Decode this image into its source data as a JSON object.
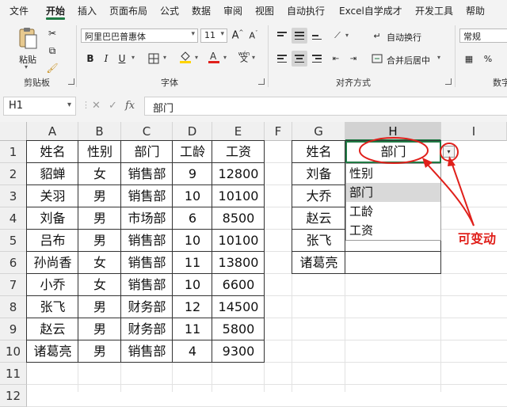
{
  "menu": {
    "items": [
      "文件",
      "开始",
      "插入",
      "页面布局",
      "公式",
      "数据",
      "审阅",
      "视图",
      "自动执行",
      "Excel自学成才",
      "开发工具",
      "帮助"
    ],
    "active_index": 1
  },
  "ribbon": {
    "clipboard": {
      "paste_label": "粘贴",
      "group_label": "剪贴板"
    },
    "font": {
      "font_name": "阿里巴巴普惠体",
      "font_size": "11",
      "group_label": "字体",
      "wen_label": "wén"
    },
    "alignment": {
      "wrap_label": "自动换行",
      "merge_label": "合并后居中",
      "group_label": "对齐方式"
    },
    "number": {
      "format": "常规",
      "group_label": "数字"
    }
  },
  "formula_bar": {
    "name_box": "H1",
    "fx_label": "fx",
    "content": "部门"
  },
  "columns": [
    "A",
    "B",
    "C",
    "D",
    "E",
    "F",
    "G",
    "H",
    "I"
  ],
  "selected_column": "H",
  "rows": [
    "1",
    "2",
    "3",
    "4",
    "5",
    "6",
    "7",
    "8",
    "9",
    "10",
    "11",
    "12"
  ],
  "table1": {
    "headers": [
      "姓名",
      "性别",
      "部门",
      "工龄",
      "工资"
    ],
    "rows": [
      [
        "貂蝉",
        "女",
        "销售部",
        "9",
        "12800"
      ],
      [
        "关羽",
        "男",
        "销售部",
        "10",
        "10100"
      ],
      [
        "刘备",
        "男",
        "市场部",
        "6",
        "8500"
      ],
      [
        "吕布",
        "男",
        "销售部",
        "10",
        "10100"
      ],
      [
        "孙尚香",
        "女",
        "销售部",
        "11",
        "13800"
      ],
      [
        "小乔",
        "女",
        "销售部",
        "10",
        "6600"
      ],
      [
        "张飞",
        "男",
        "财务部",
        "12",
        "14500"
      ],
      [
        "赵云",
        "男",
        "财务部",
        "11",
        "5800"
      ],
      [
        "诸葛亮",
        "男",
        "销售部",
        "4",
        "9300"
      ]
    ]
  },
  "table2": {
    "header_name": "姓名",
    "header_dropdown": "部门",
    "names": [
      "刘备",
      "大乔",
      "赵云",
      "张飞",
      "诸葛亮"
    ]
  },
  "dropdown": {
    "options": [
      "性别",
      "部门",
      "工龄",
      "工资"
    ],
    "highlighted_index": 1
  },
  "annotation": {
    "text": "可变动",
    "color": "#e0201b"
  },
  "colors": {
    "accent": "#1f7a44",
    "annotation": "#e0201b"
  }
}
